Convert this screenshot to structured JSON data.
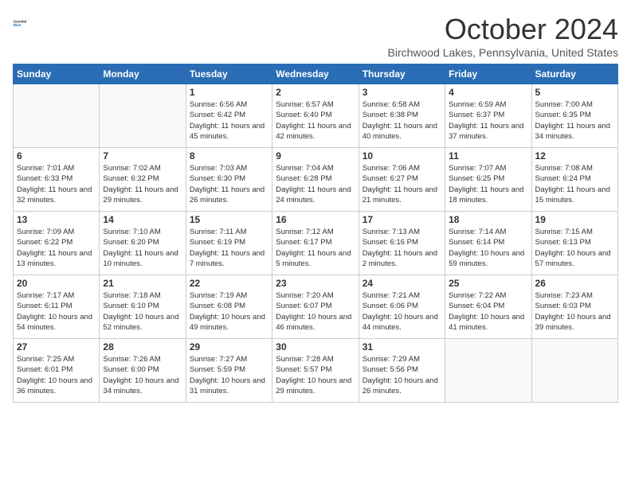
{
  "logo": {
    "general": "General",
    "blue": "Blue"
  },
  "title": "October 2024",
  "location": "Birchwood Lakes, Pennsylvania, United States",
  "days_of_week": [
    "Sunday",
    "Monday",
    "Tuesday",
    "Wednesday",
    "Thursday",
    "Friday",
    "Saturday"
  ],
  "weeks": [
    [
      {
        "day": "",
        "info": ""
      },
      {
        "day": "",
        "info": ""
      },
      {
        "day": "1",
        "info": "Sunrise: 6:56 AM\nSunset: 6:42 PM\nDaylight: 11 hours and 45 minutes."
      },
      {
        "day": "2",
        "info": "Sunrise: 6:57 AM\nSunset: 6:40 PM\nDaylight: 11 hours and 42 minutes."
      },
      {
        "day": "3",
        "info": "Sunrise: 6:58 AM\nSunset: 6:38 PM\nDaylight: 11 hours and 40 minutes."
      },
      {
        "day": "4",
        "info": "Sunrise: 6:59 AM\nSunset: 6:37 PM\nDaylight: 11 hours and 37 minutes."
      },
      {
        "day": "5",
        "info": "Sunrise: 7:00 AM\nSunset: 6:35 PM\nDaylight: 11 hours and 34 minutes."
      }
    ],
    [
      {
        "day": "6",
        "info": "Sunrise: 7:01 AM\nSunset: 6:33 PM\nDaylight: 11 hours and 32 minutes."
      },
      {
        "day": "7",
        "info": "Sunrise: 7:02 AM\nSunset: 6:32 PM\nDaylight: 11 hours and 29 minutes."
      },
      {
        "day": "8",
        "info": "Sunrise: 7:03 AM\nSunset: 6:30 PM\nDaylight: 11 hours and 26 minutes."
      },
      {
        "day": "9",
        "info": "Sunrise: 7:04 AM\nSunset: 6:28 PM\nDaylight: 11 hours and 24 minutes."
      },
      {
        "day": "10",
        "info": "Sunrise: 7:06 AM\nSunset: 6:27 PM\nDaylight: 11 hours and 21 minutes."
      },
      {
        "day": "11",
        "info": "Sunrise: 7:07 AM\nSunset: 6:25 PM\nDaylight: 11 hours and 18 minutes."
      },
      {
        "day": "12",
        "info": "Sunrise: 7:08 AM\nSunset: 6:24 PM\nDaylight: 11 hours and 15 minutes."
      }
    ],
    [
      {
        "day": "13",
        "info": "Sunrise: 7:09 AM\nSunset: 6:22 PM\nDaylight: 11 hours and 13 minutes."
      },
      {
        "day": "14",
        "info": "Sunrise: 7:10 AM\nSunset: 6:20 PM\nDaylight: 11 hours and 10 minutes."
      },
      {
        "day": "15",
        "info": "Sunrise: 7:11 AM\nSunset: 6:19 PM\nDaylight: 11 hours and 7 minutes."
      },
      {
        "day": "16",
        "info": "Sunrise: 7:12 AM\nSunset: 6:17 PM\nDaylight: 11 hours and 5 minutes."
      },
      {
        "day": "17",
        "info": "Sunrise: 7:13 AM\nSunset: 6:16 PM\nDaylight: 11 hours and 2 minutes."
      },
      {
        "day": "18",
        "info": "Sunrise: 7:14 AM\nSunset: 6:14 PM\nDaylight: 10 hours and 59 minutes."
      },
      {
        "day": "19",
        "info": "Sunrise: 7:15 AM\nSunset: 6:13 PM\nDaylight: 10 hours and 57 minutes."
      }
    ],
    [
      {
        "day": "20",
        "info": "Sunrise: 7:17 AM\nSunset: 6:11 PM\nDaylight: 10 hours and 54 minutes."
      },
      {
        "day": "21",
        "info": "Sunrise: 7:18 AM\nSunset: 6:10 PM\nDaylight: 10 hours and 52 minutes."
      },
      {
        "day": "22",
        "info": "Sunrise: 7:19 AM\nSunset: 6:08 PM\nDaylight: 10 hours and 49 minutes."
      },
      {
        "day": "23",
        "info": "Sunrise: 7:20 AM\nSunset: 6:07 PM\nDaylight: 10 hours and 46 minutes."
      },
      {
        "day": "24",
        "info": "Sunrise: 7:21 AM\nSunset: 6:06 PM\nDaylight: 10 hours and 44 minutes."
      },
      {
        "day": "25",
        "info": "Sunrise: 7:22 AM\nSunset: 6:04 PM\nDaylight: 10 hours and 41 minutes."
      },
      {
        "day": "26",
        "info": "Sunrise: 7:23 AM\nSunset: 6:03 PM\nDaylight: 10 hours and 39 minutes."
      }
    ],
    [
      {
        "day": "27",
        "info": "Sunrise: 7:25 AM\nSunset: 6:01 PM\nDaylight: 10 hours and 36 minutes."
      },
      {
        "day": "28",
        "info": "Sunrise: 7:26 AM\nSunset: 6:00 PM\nDaylight: 10 hours and 34 minutes."
      },
      {
        "day": "29",
        "info": "Sunrise: 7:27 AM\nSunset: 5:59 PM\nDaylight: 10 hours and 31 minutes."
      },
      {
        "day": "30",
        "info": "Sunrise: 7:28 AM\nSunset: 5:57 PM\nDaylight: 10 hours and 29 minutes."
      },
      {
        "day": "31",
        "info": "Sunrise: 7:29 AM\nSunset: 5:56 PM\nDaylight: 10 hours and 26 minutes."
      },
      {
        "day": "",
        "info": ""
      },
      {
        "day": "",
        "info": ""
      }
    ]
  ]
}
